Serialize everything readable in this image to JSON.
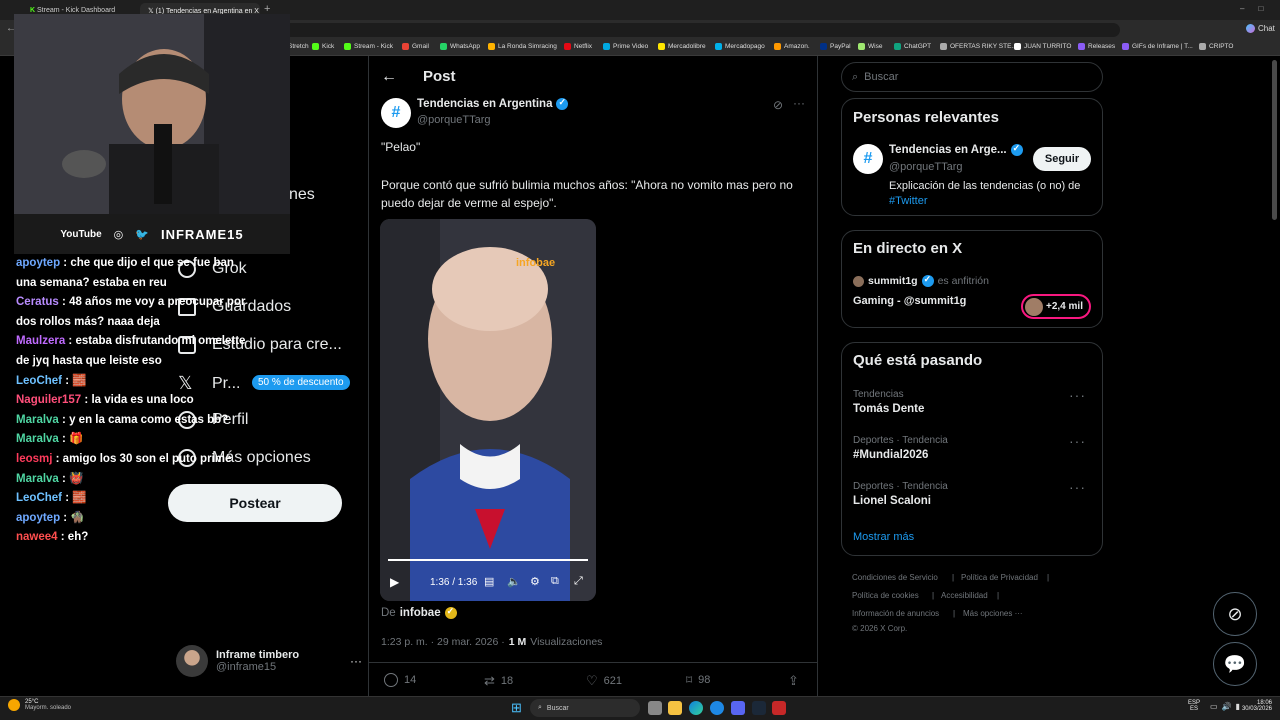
{
  "browser": {
    "tabs": [
      {
        "label": "Stream - Kick Dashboard",
        "icon": "kick-icon"
      },
      {
        "label": "(1) Tendencias en Argentina en X",
        "icon": "x-icon"
      }
    ],
    "new_tab": "+",
    "bookmarks": [
      "Stretch",
      "Kick",
      "Stream - Kick",
      "Gmail",
      "WhatsApp",
      "La Ronda Simracing",
      "Netflix",
      "Prime Video",
      "Mercadolibre",
      "Mercadopago",
      "Amazon.",
      "PayPal",
      "Wise",
      "ChatGPT",
      "OFERTAS RIKY STE...",
      "JUAN TURRITO",
      "Releases",
      "GIFs de Inframe | T...",
      "CRIPTO"
    ],
    "chat_button": "Chat",
    "bookmark_colors": [
      "#cccccc",
      "#53fc18",
      "#53fc18",
      "#ea4335",
      "#25d366",
      "#ffb300",
      "#e50914",
      "#00a8e1",
      "#ffe600",
      "#00b1ea",
      "#ff9900",
      "#003087",
      "#9fe870",
      "#10a37f",
      "#aaaaaa",
      "#ffffff",
      "#8b5cf6",
      "#8b5cf6",
      "#aaaaaa"
    ]
  },
  "stream_overlay": {
    "social": [
      "YouTube",
      "◎",
      "🐦"
    ],
    "channel_name": "INFRAME15"
  },
  "chat": [
    {
      "user": "apoytep",
      "color": "#6ea8ff",
      "text": "che que dijo el que se fue ban una semana? estaba en reu"
    },
    {
      "user": "Ceratus",
      "color": "#b98cff",
      "text": "48 años me voy a preocupar por dos rollos más? naaa deja"
    },
    {
      "user": "Maulzera",
      "color": "#c06bff",
      "text": "estaba disfrutando mi omelette de jyq hasta que leiste eso"
    },
    {
      "user": "LeoChef",
      "color": "#6ec1ff",
      "text": "🧱"
    },
    {
      "user": "Naguiler157",
      "color": "#ff4f7a",
      "text": "la vida es una loco"
    },
    {
      "user": "Maralva",
      "color": "#4fd6a3",
      "text": "y en la cama como estas bb?"
    },
    {
      "user": "Maralva",
      "color": "#4fd6a3",
      "text": "🎁"
    },
    {
      "user": "leosmj",
      "color": "#ff3b5c",
      "text": "amigo los 30 son el puto prime"
    },
    {
      "user": "Maralva",
      "color": "#4fd6a3",
      "text": "👹"
    },
    {
      "user": "LeoChef",
      "color": "#6ec1ff",
      "text": "🧱"
    },
    {
      "user": "apoytep",
      "color": "#6ea8ff",
      "text": "🧌"
    },
    {
      "user": "nawee4",
      "color": "#ff4f4f",
      "text": "eh?"
    }
  ],
  "left_nav": {
    "partial_label": "nes",
    "items": [
      {
        "label": "Grok",
        "icon": "grok-icon"
      },
      {
        "label": "Guardados",
        "icon": "bookmark-icon"
      },
      {
        "label": "Estudio para cre...",
        "icon": "studio-icon"
      },
      {
        "label": "Pr...",
        "icon": "x-premium-icon"
      },
      {
        "label": "Perfil",
        "icon": "profile-icon"
      },
      {
        "label": "Más opciones",
        "icon": "more-icon"
      }
    ],
    "premium_badge": "50 % de descuento",
    "post_button": "Postear",
    "account": {
      "name": "Inframe timbero",
      "handle": "@inframe15"
    }
  },
  "post": {
    "header_title": "Post",
    "author_name": "Tendencias en Argentina",
    "author_handle": "@porqueTTarg",
    "text_line1": "\"Pelao\"",
    "text_line2": "Porque contó que sufrió bulimia muchos años: \"Ahora no vomito mas pero no puedo dejar de verme al espejo\".",
    "video": {
      "watermark": "infobae",
      "time": "1:36 / 1:36",
      "progress": 1.0
    },
    "source_prefix": "De",
    "source": "infobae",
    "timestamp": "1:23 p. m. · 29 mar. 2026 ·",
    "views_count": "1 M",
    "views_label": "Visualizaciones",
    "actions": {
      "replies": "14",
      "reposts": "18",
      "likes": "621",
      "bookmarks": "98"
    }
  },
  "sidebar": {
    "search_placeholder": "Buscar",
    "relevant": {
      "title": "Personas relevantes",
      "name": "Tendencias en Arge...",
      "handle": "@porqueTTarg",
      "bio": "Explicación de las tendencias (o no) de",
      "bio_link": "#Twitter",
      "follow_button": "Seguir"
    },
    "live": {
      "title": "En directo en X",
      "host": "summit1g",
      "host_suffix": "es anfitrión",
      "stream_title": "Gaming - @summit1g",
      "listeners": "+2,4 mil"
    },
    "trending": {
      "title": "Qué está pasando",
      "items": [
        {
          "context": "Tendencias",
          "topic": "Tomás Dente"
        },
        {
          "context": "Deportes · Tendencia",
          "topic": "#Mundial2026"
        },
        {
          "context": "Deportes · Tendencia",
          "topic": "Lionel Scaloni"
        }
      ],
      "show_more": "Mostrar más"
    },
    "footer": {
      "links_row1": [
        "Condiciones de Servicio",
        "Política de Privacidad"
      ],
      "links_row2": [
        "Política de cookies",
        "Accesibilidad"
      ],
      "links_row3": [
        "Información de anuncios",
        "Más opciones ···"
      ],
      "copyright": "© 2026 X Corp."
    }
  },
  "taskbar": {
    "weather_temp": "25°C",
    "weather_desc": "Mayorm. soleado",
    "search": "Buscar",
    "lang_top": "ESP",
    "lang_bottom": "ES",
    "time": "18:06",
    "date": "30/03/2026"
  }
}
